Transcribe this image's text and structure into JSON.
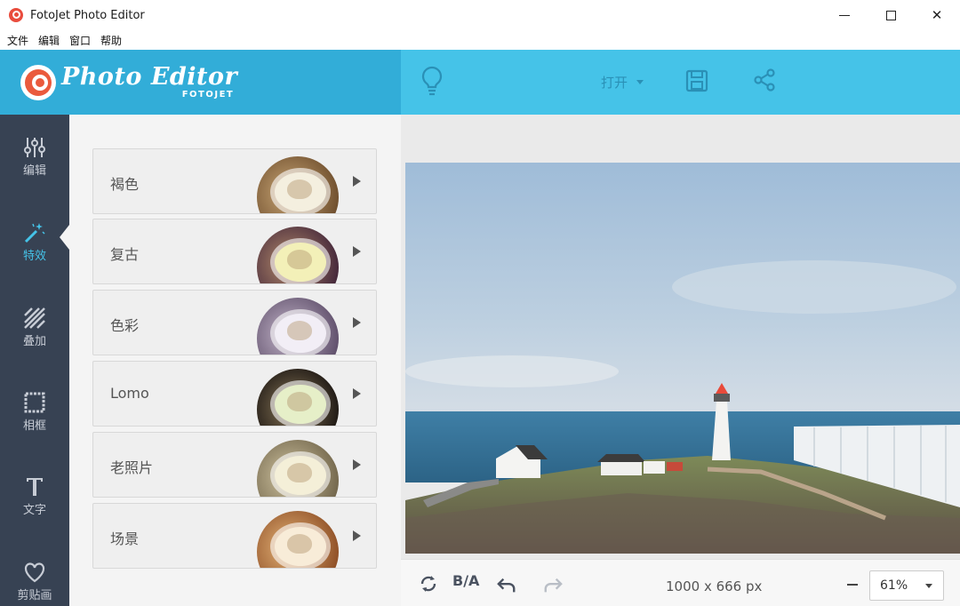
{
  "window": {
    "title": "FotoJet Photo Editor",
    "minimize_icon": "minimize-icon",
    "maximize_icon": "maximize-icon",
    "close_label": "✕"
  },
  "menubar": {
    "items": [
      {
        "label": "文件"
      },
      {
        "label": "编辑"
      },
      {
        "label": "窗口"
      },
      {
        "label": "帮助"
      }
    ]
  },
  "header": {
    "brand_name": "Photo Editor",
    "brand_sub": "FOTOJET",
    "open_label": "打开",
    "icons": [
      "lightbulb-icon",
      "save-icon",
      "share-icon"
    ],
    "colors": {
      "left": "#32add8",
      "right": "#45c3e8"
    }
  },
  "rail": {
    "items": [
      {
        "label": "编辑",
        "icon": "sliders-icon"
      },
      {
        "label": "特效",
        "icon": "magic-wand-icon",
        "active": true
      },
      {
        "label": "叠加",
        "icon": "overlay-stripes-icon"
      },
      {
        "label": "相框",
        "icon": "frame-icon"
      },
      {
        "label": "文字",
        "icon": "text-icon"
      },
      {
        "label": "剪贴画",
        "icon": "heart-icon"
      }
    ],
    "colors": {
      "background": "#374253",
      "active": "#45c3e8"
    }
  },
  "effects": {
    "items": [
      {
        "label": "褐色",
        "tint": "#b58a5a"
      },
      {
        "label": "复古",
        "tint": "#7b4a6a"
      },
      {
        "label": "色彩",
        "tint": "#9a8aa8"
      },
      {
        "label": "Lomo",
        "tint": "#3a3028"
      },
      {
        "label": "老照片",
        "tint": "#a89a78"
      },
      {
        "label": "场景",
        "tint": "#c98a4a"
      }
    ]
  },
  "canvas": {
    "image_subject": "lighthouse-seaside-photo"
  },
  "bottombar": {
    "ba_label": "B/A",
    "dimensions": "1000 x 666 px",
    "zoom": "61%",
    "icons": [
      "rotate-icon",
      "undo-icon",
      "redo-icon",
      "zoom-out-icon"
    ]
  }
}
